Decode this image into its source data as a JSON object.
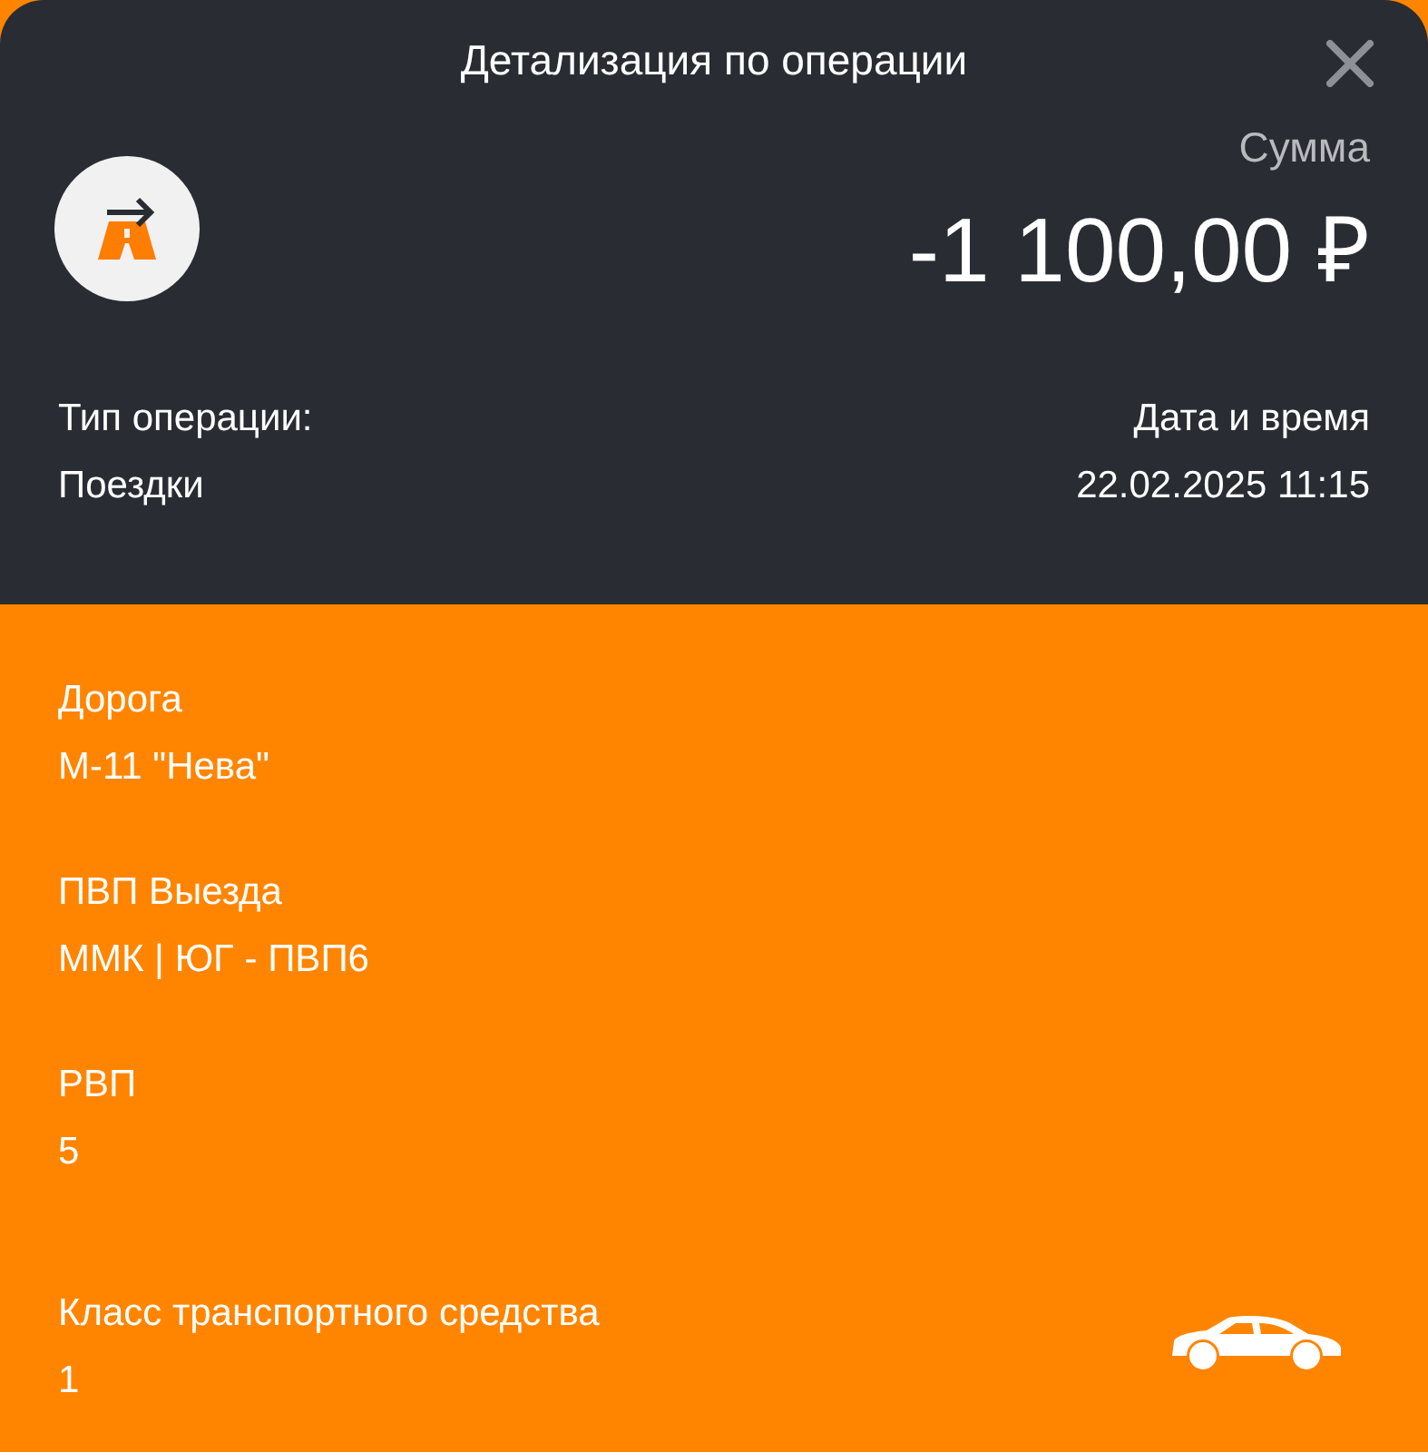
{
  "title": "Детализация по операции",
  "amount": {
    "label": "Сумма",
    "value": "-1 100,00 ₽"
  },
  "operation_type": {
    "label": "Тип операции:",
    "value": "Поездки"
  },
  "datetime": {
    "label": "Дата и время",
    "value": "22.02.2025 11:15"
  },
  "fields": [
    {
      "kind": "plain",
      "label": "Дорога",
      "value": "М-11 \"Нева\""
    },
    {
      "kind": "plain",
      "label": "ПВП Выезда",
      "value": "ММК | ЮГ - ПВП6"
    },
    {
      "kind": "plain",
      "label": "РВП",
      "value": "5"
    },
    {
      "kind": "vehicle",
      "label": "Класс транспортного средства",
      "value": "1"
    }
  ]
}
